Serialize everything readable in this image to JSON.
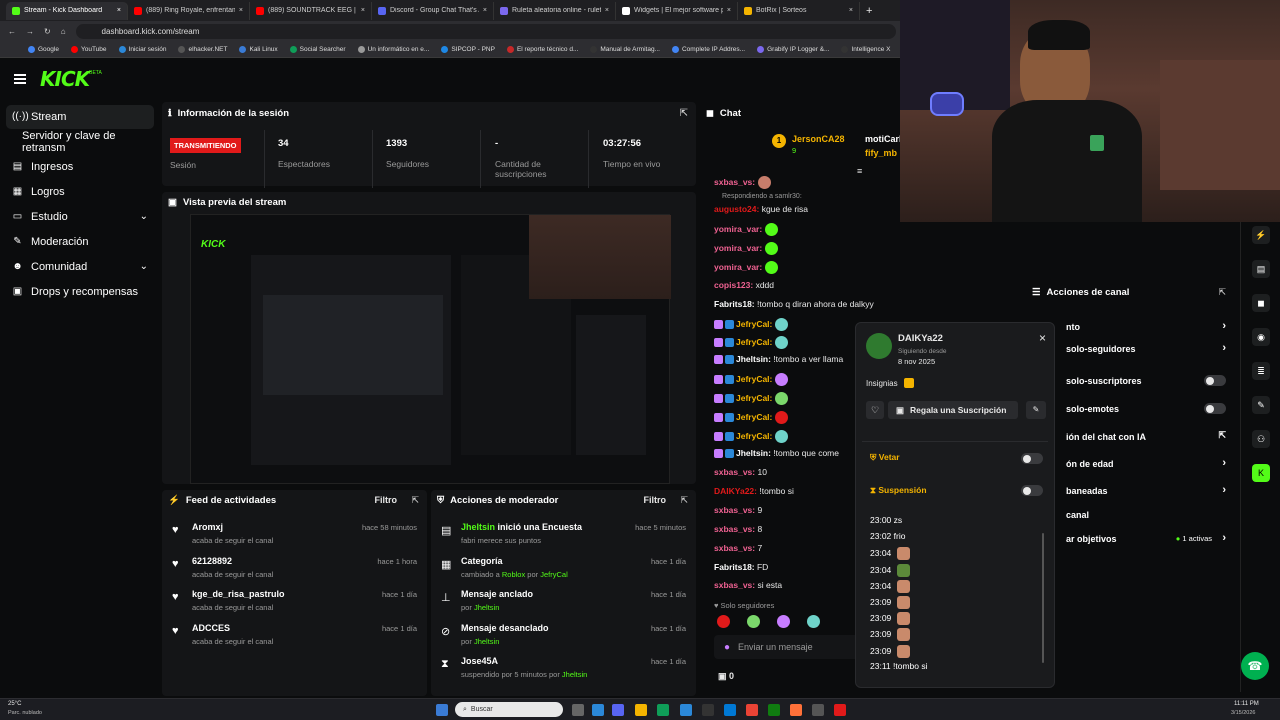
{
  "browser": {
    "tabs": [
      {
        "label": "Stream - Kick Dashboard",
        "color": "#53fc18",
        "active": true
      },
      {
        "label": "(889) Ring Royale, enfrentamie",
        "color": "#ff0000"
      },
      {
        "label": "(889) SOUNDTRACK EEG | V",
        "color": "#ff0000"
      },
      {
        "label": "Discord - Group Chat That's Al",
        "color": "#5865f2"
      },
      {
        "label": "Ruleta aleatoria online - ruleta",
        "color": "#7b68ee"
      },
      {
        "label": "Widgets | El mejor software pa",
        "color": "#ffffff"
      },
      {
        "label": "BotRix | Sorteos",
        "color": "#f4b400"
      }
    ],
    "url": "dashboard.kick.com/stream",
    "bookmarks": [
      "Google",
      "YouTube",
      "Iniciar sesión",
      "elhacker.NET",
      "Kali Linux",
      "Social Searcher",
      "Un informático en e...",
      "SIPCOP - PNP",
      "El reporte técnico d...",
      "Manual de Armitag...",
      "Complete IP Addres...",
      "Grabify IP Logger &...",
      "Intelligence X",
      "Online investigation..."
    ]
  },
  "kick": {
    "logo": "KICK",
    "beta": "BETA"
  },
  "sidebar": {
    "items": [
      {
        "label": "Stream",
        "icon": "broadcast-icon"
      },
      {
        "label": "Servidor y clave de retransm"
      },
      {
        "label": "Ingresos",
        "icon": "chart-icon"
      },
      {
        "label": "Logros",
        "icon": "trophy-icon"
      },
      {
        "label": "Estudio",
        "icon": "studio-icon"
      },
      {
        "label": "Moderación",
        "icon": "wrench-icon"
      },
      {
        "label": "Comunidad",
        "icon": "community-icon"
      },
      {
        "label": "Drops y recompensas",
        "icon": "gift-icon"
      }
    ]
  },
  "session": {
    "title": "Información de la sesión",
    "live_badge": "TRANSMITIENDO",
    "session_label": "Sesión",
    "stats": [
      {
        "value": "34",
        "label": "Espectadores"
      },
      {
        "value": "1393",
        "label": "Seguidores"
      },
      {
        "value": "-",
        "label": "Cantidad de suscripciones"
      },
      {
        "value": "03:27:56",
        "label": "Tiempo en vivo"
      }
    ]
  },
  "preview": {
    "title": "Vista previa del stream"
  },
  "activity": {
    "title": "Feed de actividades",
    "filter": "Filtro",
    "items": [
      {
        "name": "Aromxj",
        "sub": "acaba de seguir el canal",
        "time": "hace 58 minutos"
      },
      {
        "name": "62128892",
        "sub": "acaba de seguir el canal",
        "time": "hace 1 hora"
      },
      {
        "name": "kge_de_risa_pastrulo",
        "sub": "acaba de seguir el canal",
        "time": "hace 1 día"
      },
      {
        "name": "ADCCES",
        "sub": "acaba de seguir el canal",
        "time": "hace 1 día"
      }
    ]
  },
  "modactions": {
    "title": "Acciones de moderador",
    "filter": "Filtro",
    "items": [
      {
        "name": "Jheltsin",
        "name_tail": " inició una Encuesta",
        "sub": "fabri merece sus puntos",
        "time": "hace 5 minutos"
      },
      {
        "name": "Categoría",
        "sub_pre": "cambiado a ",
        "sub_a": "Roblox",
        "sub_mid": " por ",
        "sub_b": "JefryCal",
        "time": "hace 1 día"
      },
      {
        "name": "Mensaje anclado",
        "sub_pre": "por ",
        "sub_b": "Jheltsin",
        "time": "hace 1 día"
      },
      {
        "name": "Mensaje desanclado",
        "sub_pre": "por ",
        "sub_b": "Jheltsin",
        "time": "hace 1 día"
      },
      {
        "name": "Jose45A",
        "sub_pre": "suspendido por 5 minutos por ",
        "sub_b": "Jheltsin",
        "time": "hace 1 día"
      }
    ]
  },
  "chat": {
    "title": "Chat",
    "pinned_user": "JersonCA28",
    "pinned_user2": "motiCarl",
    "pinned_user3": "fify_mb",
    "pinned_count": "1",
    "pinned_sub": "9",
    "reply_to": "Respondiendo a samlr30:",
    "messages": [
      {
        "user": "sxbas_vs:",
        "text": ""
      },
      {
        "user": "augusto24:",
        "text": " kgue de risa"
      },
      {
        "user": "yomira_var:",
        "text": ""
      },
      {
        "user": "yomira_var:",
        "text": ""
      },
      {
        "user": "yomira_var:",
        "text": ""
      },
      {
        "user": "copis123:",
        "text": " xddd"
      },
      {
        "user": "Fabrits18:",
        "text": " !tombo q diran ahora de dalkyy"
      },
      {
        "user": "JefryCal:",
        "text": ""
      },
      {
        "user": "JefryCal:",
        "text": ""
      },
      {
        "user": "Jheltsin:",
        "text": " !tombo a ver llama"
      },
      {
        "user": "JefryCal:",
        "text": ""
      },
      {
        "user": "JefryCal:",
        "text": ""
      },
      {
        "user": "JefryCal:",
        "text": ""
      },
      {
        "user": "JefryCal:",
        "text": ""
      },
      {
        "user": "Jheltsin:",
        "text": " !tombo que come"
      },
      {
        "user": "sxbas_vs:",
        "text": " 10"
      },
      {
        "user": "DAIKYa22:",
        "text": " !tombo si"
      },
      {
        "user": "sxbas_vs:",
        "text": " 9"
      },
      {
        "user": "sxbas_vs:",
        "text": " 8"
      },
      {
        "user": "sxbas_vs:",
        "text": " 7"
      },
      {
        "user": "Fabrits18:",
        "text": " FD"
      },
      {
        "user": "sxbas_vs:",
        "text": " si esta"
      }
    ],
    "followers_only": "Solo seguidores",
    "input_placeholder": "Enviar un mensaje",
    "points": "0"
  },
  "popup": {
    "user": "DAIKYa22",
    "following_since_label": "Siguiendo desde",
    "following_since": "8 nov 2025",
    "badges_label": "Insignias",
    "gift_sub": "Regala una Suscripción",
    "ban": "Vetar",
    "timeout": "Suspensión",
    "history": [
      {
        "time": "23:00",
        "text": "zs"
      },
      {
        "time": "23:02",
        "text": "frio"
      },
      {
        "time": "23:04",
        "text": ""
      },
      {
        "time": "23:04",
        "text": ""
      },
      {
        "time": "23:04",
        "text": ""
      },
      {
        "time": "23:09",
        "text": ""
      },
      {
        "time": "23:09",
        "text": ""
      },
      {
        "time": "23:09",
        "text": ""
      },
      {
        "time": "23:09",
        "text": ""
      },
      {
        "time": "23:11",
        "text": "!tombo si"
      }
    ]
  },
  "channel_actions": {
    "title": "Acciones de canal",
    "items": [
      {
        "label": "nto",
        "ctl": "chevron"
      },
      {
        "label": "solo-seguidores",
        "ctl": "chevron"
      },
      {
        "label": "solo-suscriptores",
        "ctl": "toggle"
      },
      {
        "label": "solo-emotes",
        "ctl": "toggle"
      },
      {
        "label": "ión del chat con IA",
        "ctl": "external"
      },
      {
        "label": "ón de edad",
        "ctl": "chevron"
      },
      {
        "label": "baneadas",
        "ctl": "chevron"
      },
      {
        "label": "canal",
        "ctl": "none"
      },
      {
        "label": "ar objetivos",
        "ctl": "chevron",
        "extra": "1 activas"
      }
    ]
  },
  "taskbar": {
    "temp": "25°C",
    "weather": "Parc. nublado",
    "search": "Buscar",
    "time": "11:11 PM",
    "date": "3/15/2026"
  },
  "colors": {
    "kick_green": "#53fc18",
    "live_red": "#e11a1a",
    "panel": "#141517"
  }
}
